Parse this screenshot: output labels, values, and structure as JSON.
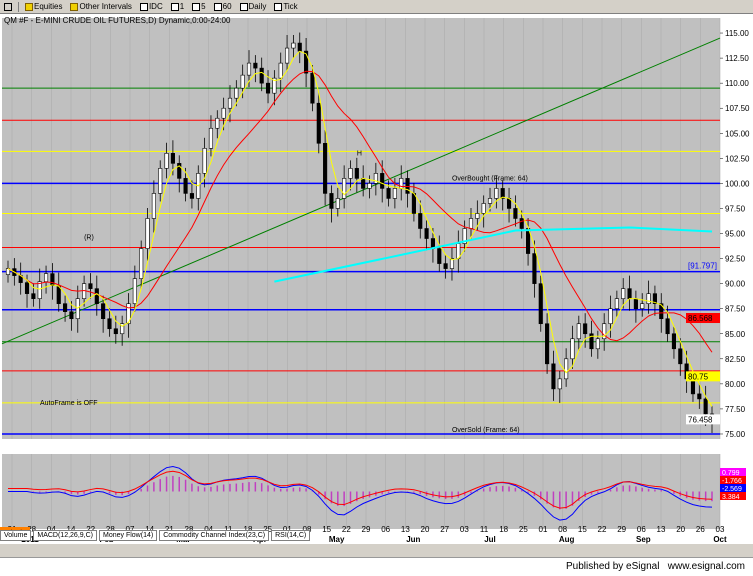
{
  "toolbar": {
    "items": [
      "Equities",
      "Other Intervals",
      "IDC",
      "1",
      "5",
      "60",
      "Daily",
      "Tick"
    ]
  },
  "chart_title": "QM #F - E-MINI CRUDE OIL FUTURES,D) Dynamic,0:00-24:00",
  "footer": {
    "text": "Published by eSignal   www.esignal.com"
  },
  "tabs": [
    "Volume",
    "MACD(12,26,9,C)",
    "Money Flow(14)",
    "Commodity Channel Index(23,C)",
    "RSI(14,C)"
  ],
  "colors": {
    "background": "#c0c0c0",
    "up_candle": "#ffffff",
    "down_candle": "#000000",
    "blue_line": "#0000ff",
    "red_line": "#ff0000",
    "yellow_line": "#ffff00",
    "green_line": "#008000",
    "cyan_line": "#00ffff"
  },
  "chart_data": {
    "type": "candlestick",
    "y_ticks": [
      "115.00",
      "112.50",
      "110.00",
      "107.50",
      "105.00",
      "102.50",
      "100.00",
      "97.50",
      "95.00",
      "92.50",
      "90.00",
      "87.50",
      "85.00",
      "82.50",
      "80.00",
      "77.50",
      "75.00"
    ],
    "ylim": [
      74.5,
      116.5
    ],
    "x_ticks": [
      "21",
      "28",
      "04",
      "14",
      "22",
      "28",
      "07",
      "14",
      "21",
      "28",
      "04",
      "11",
      "18",
      "25",
      "01",
      "08",
      "15",
      "22",
      "29",
      "06",
      "13",
      "20",
      "27",
      "03",
      "11",
      "18",
      "25",
      "01",
      "08",
      "15",
      "22",
      "29",
      "06",
      "13",
      "20",
      "26",
      "03"
    ],
    "month_labels": [
      "2011",
      "Feb",
      "Mar",
      "Apr",
      "May",
      "Jun",
      "Jul",
      "Aug",
      "Sep",
      "Oct"
    ],
    "horizontal_levels": [
      {
        "value": 109.5,
        "color": "#008000"
      },
      {
        "value": 106.3,
        "color": "#ff0000"
      },
      {
        "value": 103.2,
        "color": "#ffff00"
      },
      {
        "value": 100.0,
        "color": "#0000ff"
      },
      {
        "value": 97.0,
        "color": "#ffff00"
      },
      {
        "value": 93.6,
        "color": "#ff0000"
      },
      {
        "value": 91.2,
        "color": "#0000ff"
      },
      {
        "value": 87.4,
        "color": "#0000ff"
      },
      {
        "value": 84.2,
        "color": "#008000"
      },
      {
        "value": 81.3,
        "color": "#ff0000"
      },
      {
        "value": 78.1,
        "color": "#ffff00"
      },
      {
        "value": 75.0,
        "color": "#0000ff"
      }
    ],
    "annotations": [
      "OverBought (Frame: 64)",
      "OverSold (Frame: 64)",
      "AutoFrame is OFF",
      "H",
      "(R)"
    ],
    "price_labels": [
      "[91.797]",
      "86.568",
      "80.75",
      "76.458"
    ],
    "macd_labels": [
      "0.799",
      "-1.766",
      "-2.569",
      "3.384"
    ],
    "date_badge": "12/22/10",
    "closes": [
      91.5,
      90.8,
      90.1,
      89.0,
      88.5,
      90.2,
      91.0,
      89.8,
      88.0,
      87.2,
      86.5,
      88.5,
      90.0,
      89.5,
      88.0,
      86.5,
      85.5,
      85.0,
      86.0,
      88.0,
      90.5,
      93.5,
      96.5,
      99.0,
      101.5,
      103.0,
      102.0,
      100.5,
      99.0,
      98.5,
      101.0,
      103.5,
      105.5,
      106.5,
      107.5,
      108.5,
      109.5,
      110.8,
      112.0,
      111.5,
      110.0,
      109.0,
      110.5,
      112.0,
      113.5,
      114.0,
      113.2,
      111.0,
      108.0,
      104.0,
      99.0,
      97.5,
      98.5,
      100.5,
      101.5,
      100.5,
      99.5,
      100.0,
      101.0,
      99.5,
      98.5,
      99.5,
      100.5,
      99.0,
      97.0,
      95.5,
      94.5,
      93.5,
      92.0,
      91.5,
      92.5,
      94.0,
      95.5,
      96.5,
      97.0,
      98.0,
      98.5,
      99.5,
      98.5,
      97.5,
      96.5,
      95.5,
      93.0,
      90.0,
      86.0,
      82.0,
      79.5,
      80.5,
      82.5,
      84.5,
      86.0,
      85.0,
      83.5,
      84.5,
      86.0,
      87.5,
      88.5,
      89.5,
      88.5,
      87.5,
      88.0,
      89.0,
      88.0,
      86.5,
      85.0,
      83.5,
      82.0,
      80.5,
      79.0,
      78.5,
      77.0,
      76.5
    ]
  }
}
